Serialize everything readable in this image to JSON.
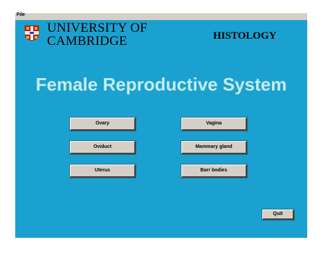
{
  "menubar": {
    "file_label": "File"
  },
  "header": {
    "university_line1": "UNIVERSITY OF",
    "university_line2": "CAMBRIDGE",
    "crest_icon": "university-crest-icon",
    "section": "HISTOLOGY"
  },
  "main": {
    "title": "Female Reproductive System",
    "buttons_left": [
      "Ovary",
      "Oviduct",
      "Uterus"
    ],
    "buttons_right": [
      "Vagina",
      "Mammary gland",
      "Barr bodies"
    ]
  },
  "footer": {
    "quit_label": "Quit"
  },
  "colors": {
    "background": "#1ba1d0",
    "title": "#c6ece8",
    "button": "#d4d0c8"
  }
}
